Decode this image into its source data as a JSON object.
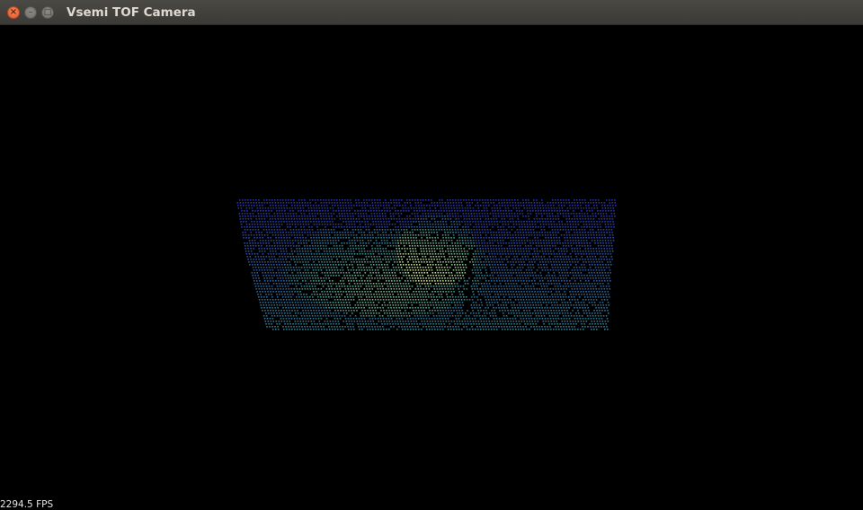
{
  "window": {
    "title": "Vsemi TOF Camera",
    "close_glyph": "×",
    "minimize_glyph": "–",
    "maximize_glyph": "□"
  },
  "viewport": {
    "description_icon": "point-cloud-view",
    "fps_label": "2294.5 FPS",
    "colors": {
      "background": "#000000",
      "far": "#2a2e9a",
      "mid": "#2f7f8a",
      "near": "#c6dd8a"
    }
  }
}
